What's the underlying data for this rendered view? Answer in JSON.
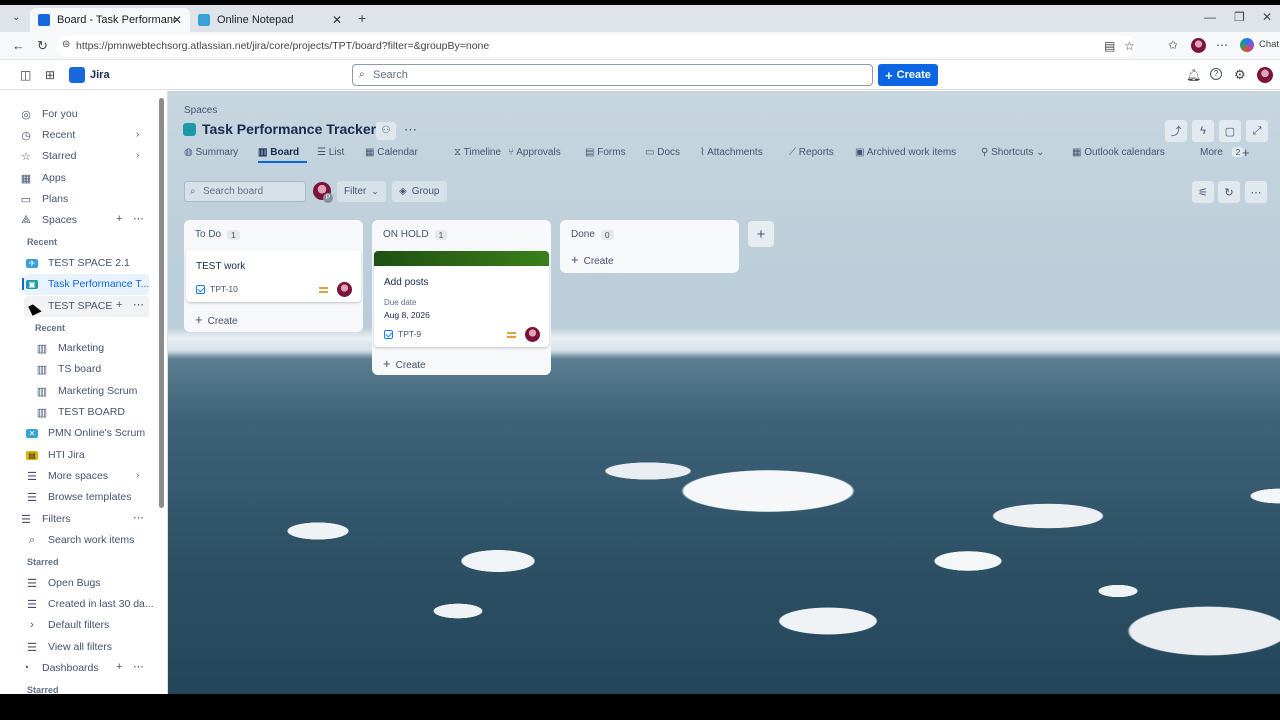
{
  "browser": {
    "tabs": [
      {
        "title": "Board - Task Performance Tracker"
      },
      {
        "title": "Online Notepad"
      }
    ],
    "url": "https://pmnwebtechsorg.atlassian.net/jira/core/projects/TPT/board?filter=&groupBy=none",
    "chat_label": "Chat"
  },
  "topnav": {
    "app_name": "Jira",
    "search_placeholder": "Search",
    "create_label": "Create"
  },
  "sidebar": {
    "top_items": [
      {
        "label": "For you",
        "icon": "person-circle-icon"
      },
      {
        "label": "Recent",
        "icon": "clock-icon"
      },
      {
        "label": "Starred",
        "icon": "star-icon"
      },
      {
        "label": "Apps",
        "icon": "apps-icon"
      },
      {
        "label": "Plans",
        "icon": "plans-icon"
      },
      {
        "label": "Spaces",
        "icon": "spaces-icon"
      }
    ],
    "recent_heading": "Recent",
    "spaces": [
      {
        "label": "TEST SPACE 2.1"
      },
      {
        "label": "Task Performance T..."
      },
      {
        "label": "TEST SPACE"
      }
    ],
    "sub_recent_heading": "Recent",
    "boards": [
      {
        "label": "Marketing"
      },
      {
        "label": "TS board"
      },
      {
        "label": "Marketing Scrum"
      },
      {
        "label": "TEST BOARD"
      }
    ],
    "other_spaces": [
      {
        "label": "PMN Online's Scrum"
      },
      {
        "label": "HTI Jira"
      }
    ],
    "more_spaces": "More spaces",
    "browse_templates": "Browse templates",
    "filters_label": "Filters",
    "search_work_items": "Search work items",
    "starred_heading": "Starred",
    "starred_filters": [
      {
        "label": "Open Bugs"
      },
      {
        "label": "Created in last 30 da..."
      }
    ],
    "default_filters": "Default filters",
    "view_all_filters": "View all filters",
    "dashboards_label": "Dashboards",
    "dashboards_starred": "Starred"
  },
  "project": {
    "breadcrumb": "Spaces",
    "title": "Task Performance Tracker",
    "tabs": [
      {
        "label": "Summary"
      },
      {
        "label": "Board"
      },
      {
        "label": "List"
      },
      {
        "label": "Calendar"
      },
      {
        "label": "Timeline"
      },
      {
        "label": "Approvals"
      },
      {
        "label": "Forms"
      },
      {
        "label": "Docs"
      },
      {
        "label": "Attachments"
      },
      {
        "label": "Reports"
      },
      {
        "label": "Archived work items"
      },
      {
        "label": "Shortcuts"
      },
      {
        "label": "Outlook calendars"
      },
      {
        "label": "More"
      }
    ],
    "more_count": "2"
  },
  "board": {
    "search_placeholder": "Search board",
    "filter_label": "Filter",
    "group_label": "Group",
    "avatar_badge": "P",
    "columns": [
      {
        "name": "To Do",
        "count": "1",
        "cards": [
          {
            "title": "TEST work",
            "key": "TPT-10"
          }
        ]
      },
      {
        "name": "ON HOLD",
        "count": "1",
        "cards": [
          {
            "title": "Add posts",
            "due_label": "Due date",
            "due_value": "Aug 8, 2026",
            "key": "TPT-9"
          }
        ]
      },
      {
        "name": "Done",
        "count": "0",
        "cards": []
      }
    ],
    "create_label": "Create",
    "cover_color": "#2f6e16"
  }
}
